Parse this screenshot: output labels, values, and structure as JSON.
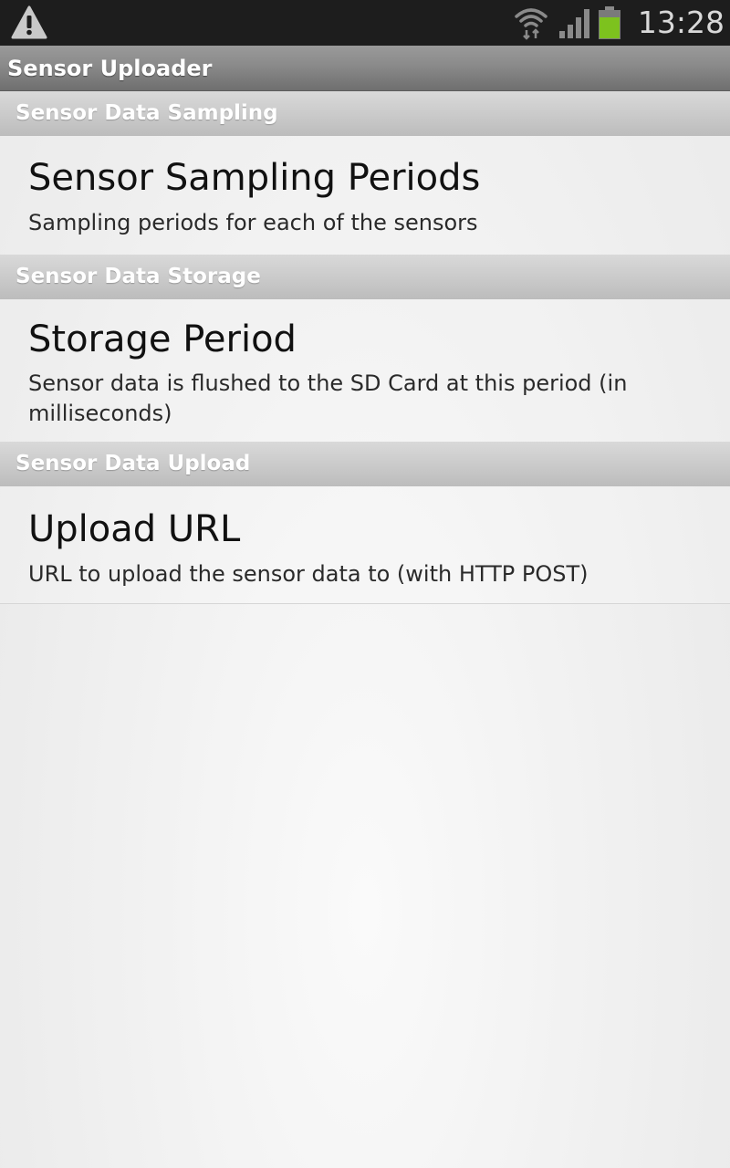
{
  "status_bar": {
    "time": "13:28",
    "icons": [
      "warning-icon",
      "wifi-icon",
      "cell-signal-icon",
      "battery-icon"
    ],
    "battery_color": "#7dc21e"
  },
  "app": {
    "title": "Sensor Uploader"
  },
  "sections": [
    {
      "header": "Sensor Data Sampling",
      "item": {
        "title": "Sensor Sampling Periods",
        "summary": "Sampling periods for each of the sensors"
      }
    },
    {
      "header": "Sensor Data Storage",
      "item": {
        "title": "Storage Period",
        "summary": "Sensor data is flushed to the SD Card at this period (in milliseconds)"
      }
    },
    {
      "header": "Sensor Data Upload",
      "item": {
        "title": "Upload URL",
        "summary": "URL to upload the sensor data to (with HTTP POST)"
      }
    }
  ]
}
